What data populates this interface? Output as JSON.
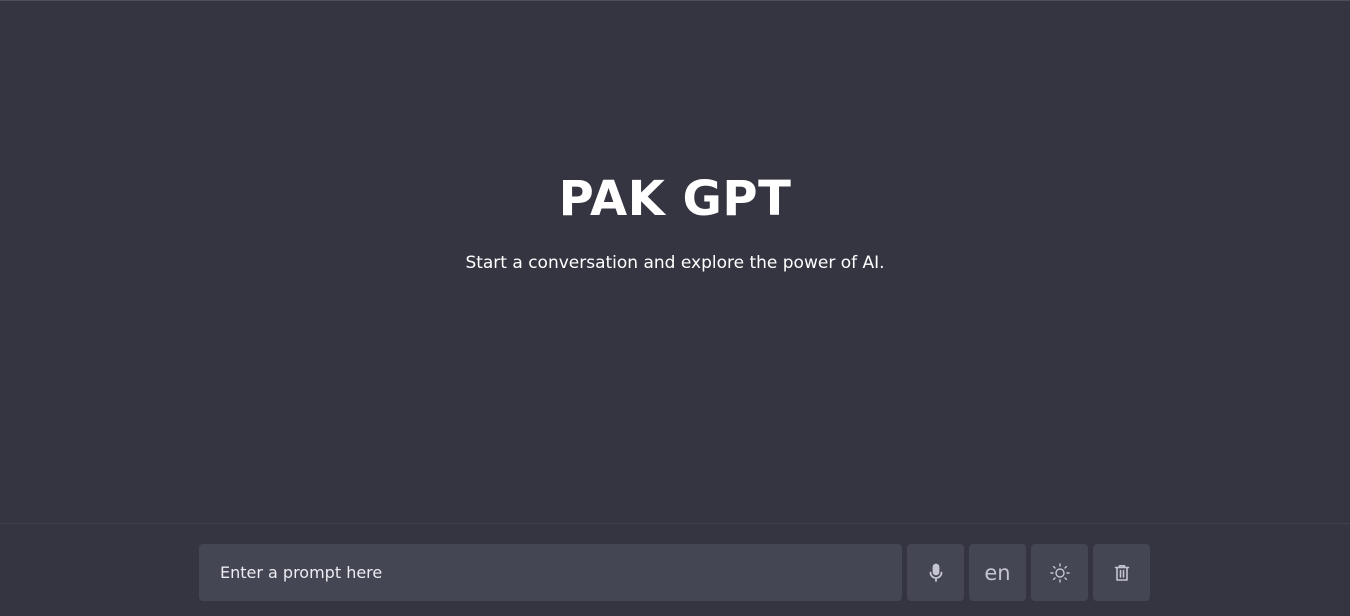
{
  "hero": {
    "title": "PAK GPT",
    "subtitle": "Start a conversation and explore the power of AI."
  },
  "footer": {
    "prompt_placeholder": "Enter a prompt here",
    "prompt_value": "",
    "buttons": {
      "mic_icon": "microphone-icon",
      "language_label": "en",
      "theme_icon": "sun-icon",
      "delete_icon": "trash-icon"
    }
  },
  "colors": {
    "background": "#343541",
    "input_background": "#444654",
    "text": "#ffffff",
    "icon": "#c5c5d2"
  }
}
